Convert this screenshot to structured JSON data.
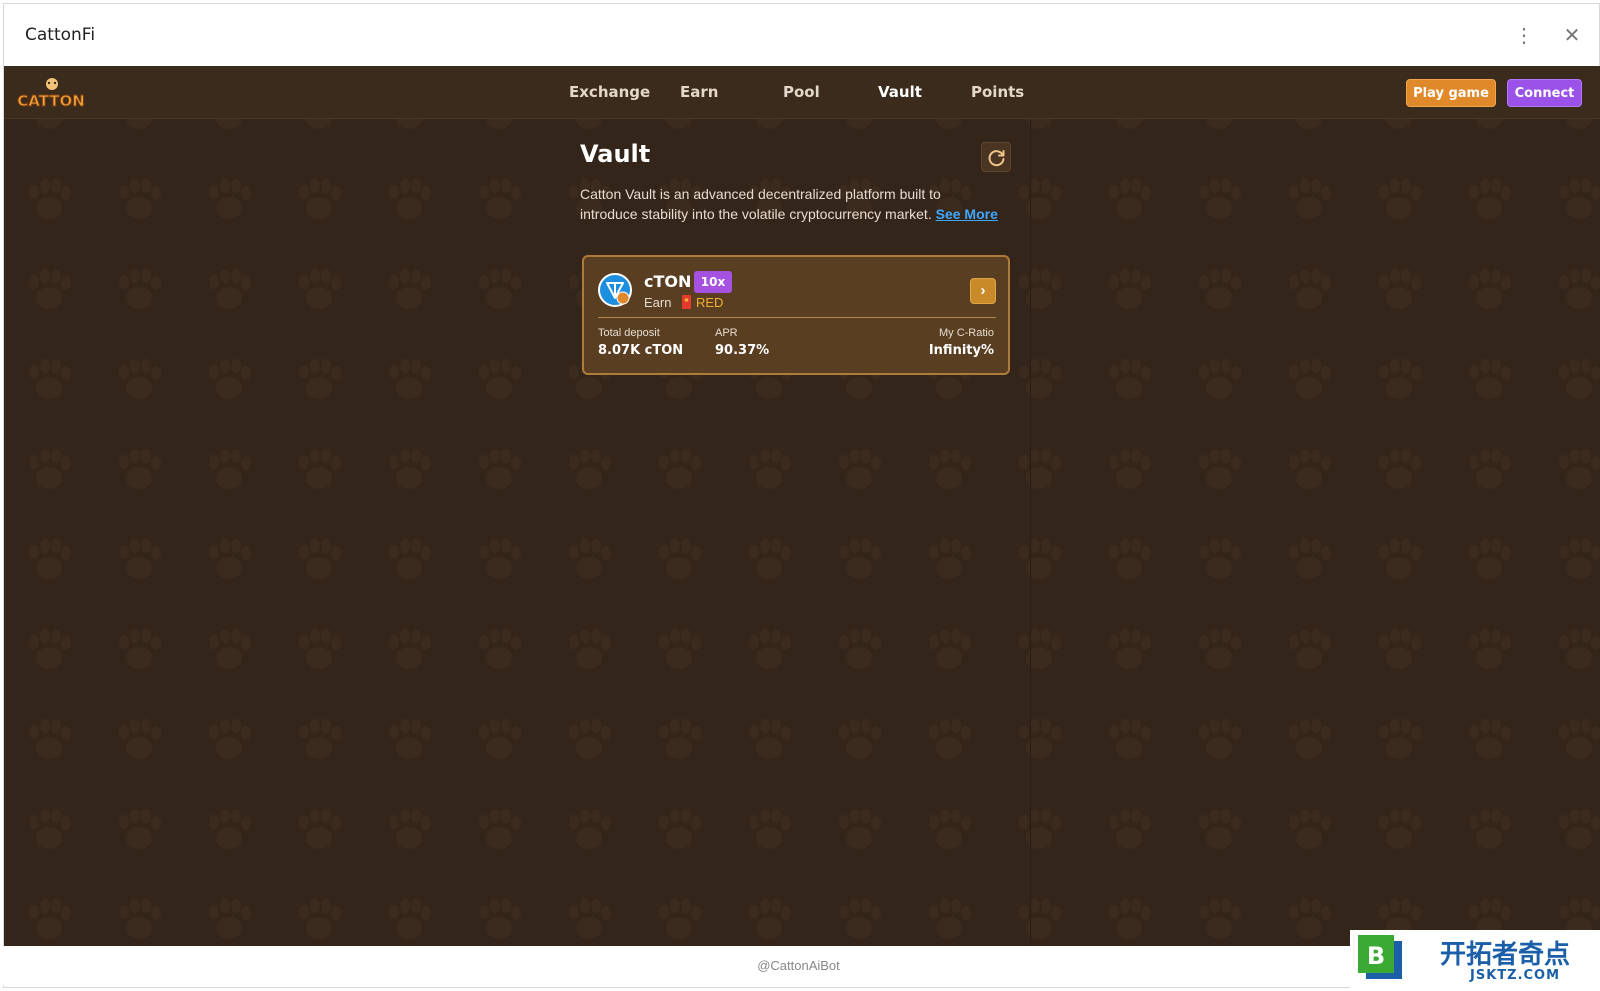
{
  "window": {
    "title": "CattonFi",
    "menu_icon": "kebab-menu-icon",
    "close_icon": "close-icon"
  },
  "header": {
    "logo_text": "CATTON",
    "nav": [
      "Exchange",
      "Earn",
      "Pool",
      "Vault",
      "Points"
    ],
    "active_nav": "Vault",
    "play_label": "Play game",
    "connect_label": "Connect"
  },
  "vault": {
    "title": "Vault",
    "description": "Catton Vault is an advanced decentralized platform built to introduce stability into the volatile cryptocurrency market.",
    "see_more": "See More",
    "card": {
      "token": "cTON",
      "multiplier": "10x",
      "earn_label": "Earn",
      "earn_token": "RED",
      "stats": {
        "total_deposit_label": "Total deposit",
        "total_deposit_value": "8.07K cTON",
        "apr_label": "APR",
        "apr_value": "90.37%",
        "c_ratio_label": "My C-Ratio",
        "c_ratio_value": "Infinity%"
      }
    }
  },
  "footer": {
    "bot": "@CattonAiBot"
  },
  "watermark": {
    "title": "开拓者奇点",
    "sub": "JSKTZ.COM"
  },
  "colors": {
    "background": "#33251a",
    "accent_orange": "#e0892a",
    "accent_purple": "#9b52e8",
    "link": "#3ea8ff"
  }
}
